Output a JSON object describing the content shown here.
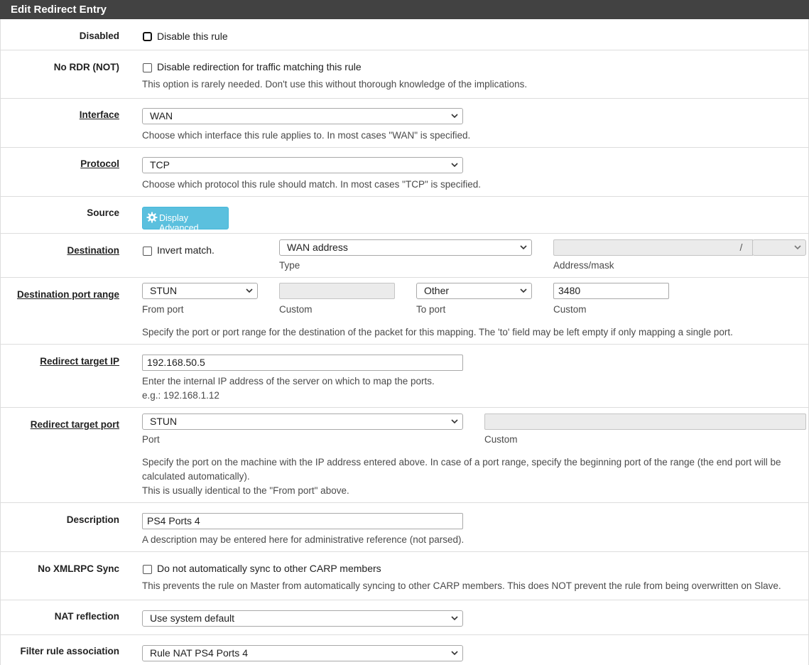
{
  "panel": {
    "title": "Edit Redirect Entry"
  },
  "disabled": {
    "label": "Disabled",
    "checkbox_label": "Disable this rule",
    "checked": false
  },
  "nordr": {
    "label": "No RDR (NOT)",
    "checkbox_label": "Disable redirection for traffic matching this rule",
    "help": "This option is rarely needed. Don't use this without thorough knowledge of the implications."
  },
  "interface": {
    "label": "Interface",
    "value": "WAN",
    "help": "Choose which interface this rule applies to. In most cases \"WAN\" is specified."
  },
  "protocol": {
    "label": "Protocol",
    "value": "TCP",
    "help": "Choose which protocol this rule should match. In most cases \"TCP\" is specified."
  },
  "source": {
    "label": "Source",
    "button": "Display Advanced"
  },
  "destination": {
    "label": "Destination",
    "invert_label": "Invert match.",
    "type_value": "WAN address",
    "type_caption": "Type",
    "address_value": "",
    "slash": "/",
    "mask_value": "",
    "address_caption": "Address/mask"
  },
  "dest_port": {
    "label": "Destination port range",
    "from_value": "STUN",
    "from_caption": "From port",
    "from_custom_value": "",
    "from_custom_caption": "Custom",
    "to_value": "Other",
    "to_caption": "To port",
    "to_custom_value": "3480",
    "to_custom_caption": "Custom",
    "help": "Specify the port or port range for the destination of the packet for this mapping. The 'to' field may be left empty if only mapping a single port."
  },
  "target_ip": {
    "label": "Redirect target IP",
    "value": "192.168.50.5",
    "help": "Enter the internal IP address of the server on which to map the ports.",
    "example": "e.g.: 192.168.1.12"
  },
  "target_port": {
    "label": "Redirect target port",
    "value": "STUN",
    "port_caption": "Port",
    "custom_value": "",
    "custom_caption": "Custom",
    "help1": "Specify the port on the machine with the IP address entered above. In case of a port range, specify the beginning port of the range (the end port will be",
    "help2": "calculated automatically).",
    "help3": "This is usually identical to the \"From port\" above."
  },
  "description": {
    "label": "Description",
    "value": "PS4 Ports 4",
    "help": "A description may be entered here for administrative reference (not parsed)."
  },
  "xmlrpc": {
    "label": "No XMLRPC Sync",
    "checkbox_label": "Do not automatically sync to other CARP members",
    "help": "This prevents the rule on Master from automatically syncing to other CARP members. This does NOT prevent the rule from being overwritten on Slave."
  },
  "nat_reflection": {
    "label": "NAT reflection",
    "value": "Use system default"
  },
  "filter_assoc": {
    "label": "Filter rule association",
    "value": "Rule NAT PS4 Ports 4"
  },
  "colors": {
    "header_bg": "#424242",
    "info_button": "#5bc0de"
  }
}
